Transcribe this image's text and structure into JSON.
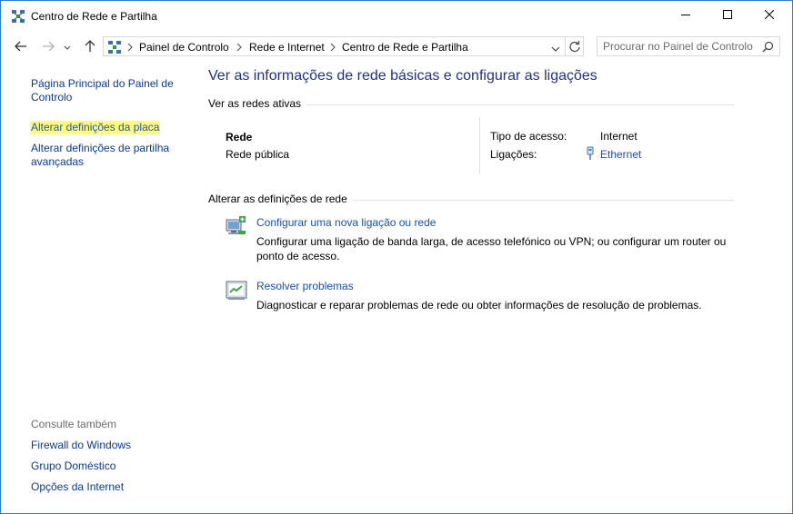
{
  "window": {
    "title": "Centro de Rede e Partilha"
  },
  "address": {
    "crumbs": [
      "Painel de Controlo",
      "Rede e Internet",
      "Centro de Rede e Partilha"
    ]
  },
  "search": {
    "placeholder": "Procurar no Painel de Controlo"
  },
  "sidebar": {
    "items": [
      {
        "label": "Página Principal do Painel de Controlo"
      },
      {
        "label": "Alterar definições da placa"
      },
      {
        "label": "Alterar definições de partilha avançadas"
      }
    ],
    "see_also_label": "Consulte também",
    "see_also": [
      {
        "label": "Firewall do Windows"
      },
      {
        "label": "Grupo Doméstico"
      },
      {
        "label": "Opções da Internet"
      }
    ]
  },
  "main": {
    "heading": "Ver as informações de rede básicas e configurar as ligações",
    "active_networks_label": "Ver as redes ativas",
    "network": {
      "name": "Rede",
      "profile": "Rede pública",
      "access_type_label": "Tipo de acesso:",
      "access_type_value": "Internet",
      "connections_label": "Ligações:",
      "connections_value": "Ethernet"
    },
    "change_settings_label": "Alterar as definições de rede",
    "tasks": [
      {
        "link": "Configurar uma nova ligação ou rede",
        "description": "Configurar uma ligação de banda larga, de acesso telefónico ou VPN; ou configurar um router ou ponto de acesso."
      },
      {
        "link": "Resolver problemas",
        "description": "Diagnosticar e reparar problemas de rede ou obter informações de resolução de problemas."
      }
    ]
  },
  "colors": {
    "link": "#1a4fb0",
    "heading": "#1e3287",
    "highlight": "#fffb7a",
    "window_border": "#2b7cd3"
  }
}
